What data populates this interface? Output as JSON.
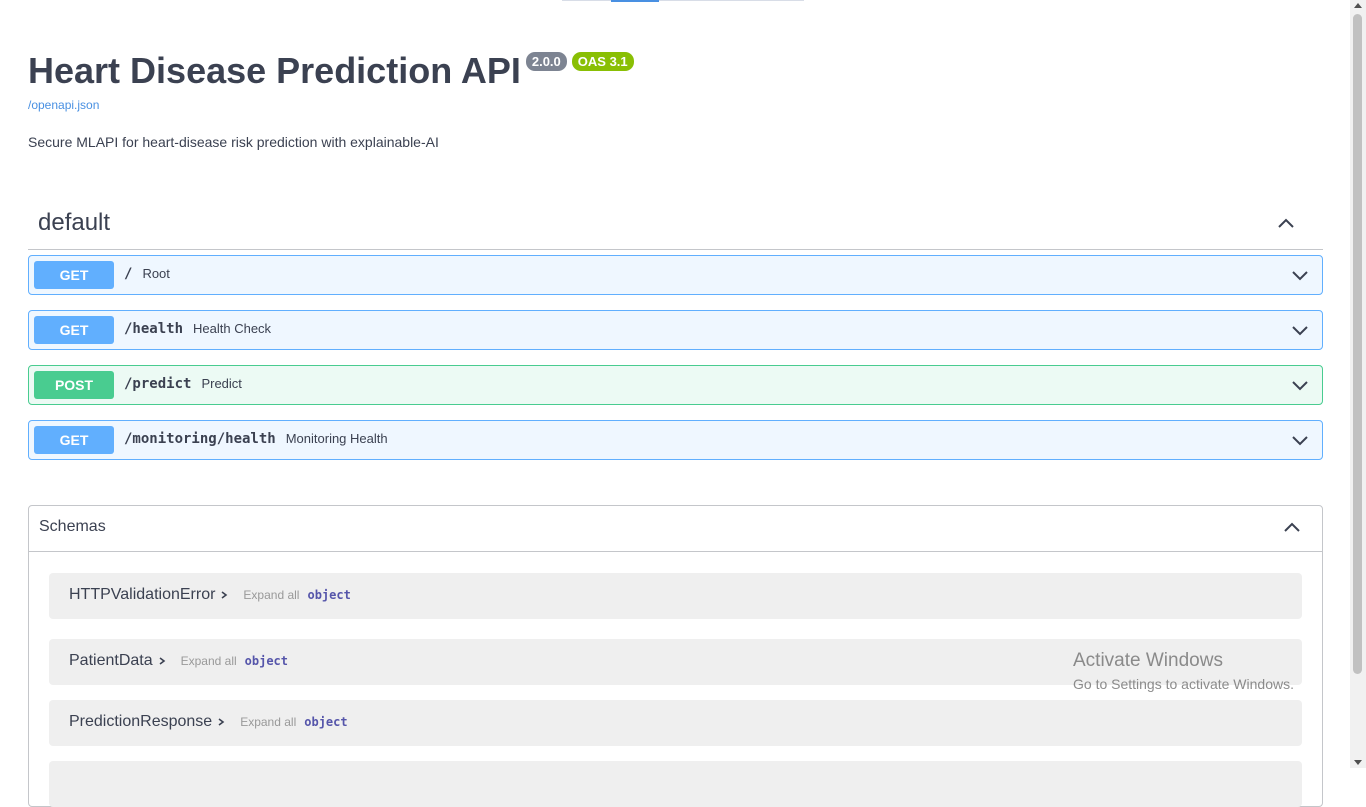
{
  "info": {
    "title": "Heart Disease Prediction API",
    "version": "2.0.0",
    "oas": "OAS 3.1",
    "spec_link": "/openapi.json",
    "description": "Secure MLAPI for heart-disease risk prediction with explainable-AI"
  },
  "tag": {
    "name": "default"
  },
  "operations": [
    {
      "method": "GET",
      "path": "/",
      "summary": "Root"
    },
    {
      "method": "GET",
      "path": "/health",
      "summary": "Health Check"
    },
    {
      "method": "POST",
      "path": "/predict",
      "summary": "Predict"
    },
    {
      "method": "GET",
      "path": "/monitoring/health",
      "summary": "Monitoring Health"
    }
  ],
  "schemas": {
    "title": "Schemas",
    "expand_all_label": "Expand all",
    "type_label": "object",
    "models": [
      {
        "name": "HTTPValidationError"
      },
      {
        "name": "PatientData"
      },
      {
        "name": "PredictionResponse"
      }
    ]
  },
  "watermark": {
    "title": "Activate Windows",
    "subtitle": "Go to Settings to activate Windows."
  },
  "colors": {
    "get": "#61affe",
    "post": "#49cc90",
    "version_badge": "#7d8492",
    "oas_badge": "#89bf04",
    "link": "#4990e2"
  },
  "icons": {
    "collapse": "chevron-up-icon",
    "expand": "chevron-down-icon",
    "model_arrow": "chevron-right-icon"
  }
}
